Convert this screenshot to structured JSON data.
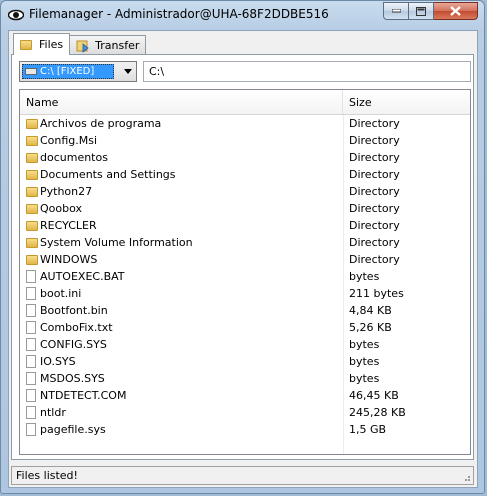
{
  "window": {
    "title": "Filemanager - Administrador@UHA-68F2DDBE516"
  },
  "tabs": [
    {
      "label": "Files",
      "icon": "folder-icon",
      "active": true
    },
    {
      "label": "Transfer",
      "icon": "transfer-icon",
      "active": false
    }
  ],
  "drive": {
    "selected": "C:\\ [FIXED]"
  },
  "path": {
    "value": "C:\\"
  },
  "columns": {
    "name": "Name",
    "size": "Size"
  },
  "rows": [
    {
      "name": "Archivos de programa",
      "size": "Directory",
      "type": "folder"
    },
    {
      "name": "Config.Msi",
      "size": "Directory",
      "type": "folder"
    },
    {
      "name": "documentos",
      "size": "Directory",
      "type": "folder"
    },
    {
      "name": "Documents and Settings",
      "size": "Directory",
      "type": "folder"
    },
    {
      "name": "Python27",
      "size": "Directory",
      "type": "folder"
    },
    {
      "name": "Qoobox",
      "size": "Directory",
      "type": "folder"
    },
    {
      "name": "RECYCLER",
      "size": "Directory",
      "type": "folder"
    },
    {
      "name": "System Volume Information",
      "size": "Directory",
      "type": "folder"
    },
    {
      "name": "WINDOWS",
      "size": "Directory",
      "type": "folder"
    },
    {
      "name": "AUTOEXEC.BAT",
      "size": " bytes",
      "type": "file"
    },
    {
      "name": "boot.ini",
      "size": "211 bytes",
      "type": "file"
    },
    {
      "name": "Bootfont.bin",
      "size": "4,84 KB",
      "type": "file"
    },
    {
      "name": "ComboFix.txt",
      "size": "5,26 KB",
      "type": "file"
    },
    {
      "name": "CONFIG.SYS",
      "size": " bytes",
      "type": "file"
    },
    {
      "name": "IO.SYS",
      "size": " bytes",
      "type": "file"
    },
    {
      "name": "MSDOS.SYS",
      "size": " bytes",
      "type": "file"
    },
    {
      "name": "NTDETECT.COM",
      "size": "46,45 KB",
      "type": "file"
    },
    {
      "name": "ntldr",
      "size": "245,28 KB",
      "type": "file"
    },
    {
      "name": "pagefile.sys",
      "size": "1,5 GB",
      "type": "file"
    }
  ],
  "status": {
    "text": "Files listed!"
  }
}
